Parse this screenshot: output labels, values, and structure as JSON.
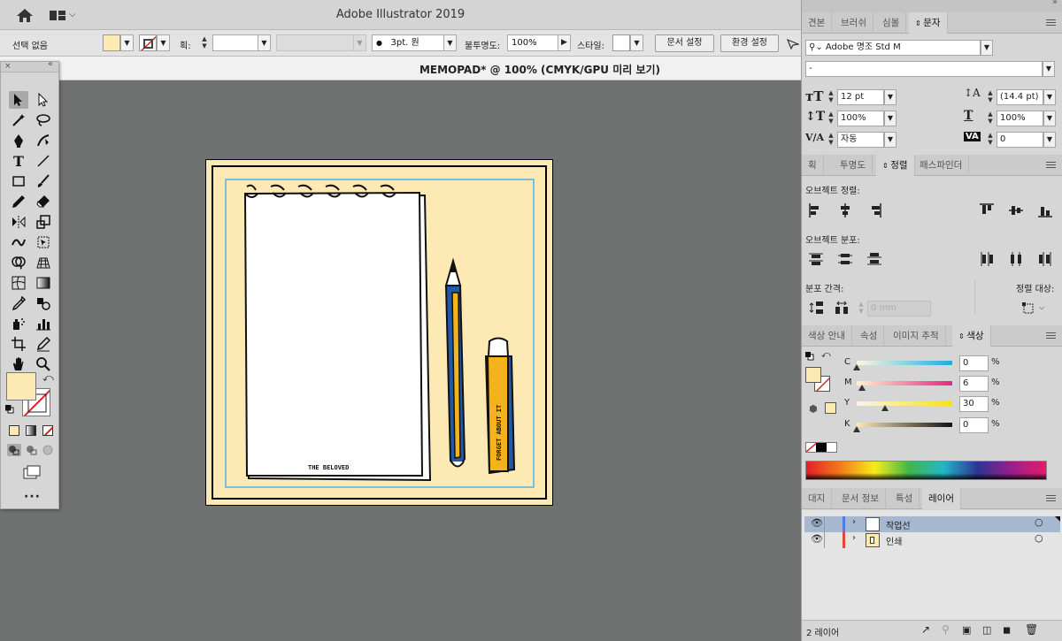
{
  "app": {
    "title": "Adobe Illustrator 2019"
  },
  "document": {
    "tab_title": "MEMOPAD* @ 100% (CMYK/GPU 미리 보기)"
  },
  "control_bar": {
    "selection_label": "선택 없음",
    "stroke_label": "획:",
    "brush_value": "3pt. 원",
    "opacity_label": "불투명도:",
    "opacity_value": "100%",
    "style_label": "스타일:",
    "doc_setup_btn": "문서 설정",
    "prefs_btn": "환경 설정"
  },
  "panels": {
    "top_tabs": [
      "견본",
      "브러쉬",
      "심볼",
      "문자"
    ],
    "character": {
      "font_family": "Adobe 명조 Std M",
      "font_style": "-",
      "size": "12 pt",
      "leading": "(14.4 pt)",
      "vscale": "100%",
      "hscale": "100%",
      "kerning": "자동",
      "tracking": "0"
    },
    "align_tabs": [
      "획",
      "투명도",
      "정렬",
      "패스파인더"
    ],
    "align": {
      "align_objects_label": "오브젝트 정렬:",
      "distribute_objects_label": "오브젝트 분포:",
      "distribute_spacing_label": "분포 간격:",
      "align_to_label": "정렬 대상:",
      "spacing_value": "0 mm"
    },
    "color_tabs": [
      "색상 안내",
      "속성",
      "이미지 추적",
      "색상"
    ],
    "color": {
      "c_label": "C",
      "c_value": "0",
      "m_label": "M",
      "m_value": "6",
      "y_label": "Y",
      "y_value": "30",
      "k_label": "K",
      "k_value": "0",
      "unit": "%",
      "c_fraction": 0.0,
      "m_fraction": 0.06,
      "y_fraction": 0.3,
      "k_fraction": 0.0
    },
    "layer_tabs": [
      "대지",
      "문서 정보",
      "특성",
      "레이어"
    ],
    "layers": [
      {
        "name": "작업선",
        "color": "#4d7ed9"
      },
      {
        "name": "인쇄",
        "color": "#e0483a"
      }
    ],
    "layers_count": "2 레이어"
  },
  "colors": {
    "fill": "#fde9b4",
    "artboard_border": "#000000",
    "guide": "#29a6e0",
    "pencil_blue": "#1e5aa6",
    "pencil_yellow": "#f4b21c"
  },
  "artwork": {
    "memo_text": "THE BELOVED",
    "eraser_text": "FORGET ABOUT IT"
  }
}
